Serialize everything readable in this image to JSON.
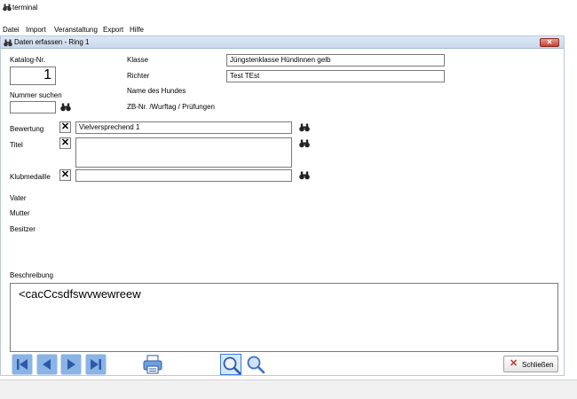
{
  "app": {
    "title": "terminal",
    "icon": "binoculars-icon"
  },
  "menu": [
    "Datei",
    "Import",
    "Veranstaltung",
    "Export",
    "Hilfe"
  ],
  "window": {
    "title": "Daten erfassen - Ring 1",
    "icon": "binoculars-icon",
    "close_label": "✕"
  },
  "form": {
    "katalog_label": "Katalog-Nr.",
    "katalog_value": "1",
    "nummer_suchen_label": "Nummer suchen",
    "nummer_suchen_value": "",
    "klasse_label": "Klasse",
    "klasse_value": "Jüngstenklasse Hündinnen gelb",
    "richter_label": "Richter",
    "richter_value": "Test TEst",
    "name_label": "Name des Hundes",
    "zb_label": "ZB-Nr. /Wurftag / Prüfungen",
    "bewertung_label": "Bewertung",
    "bewertung_value": "Vielversprechend 1",
    "titel_label": "Titel",
    "titel_value": "",
    "klubmedaille_label": "Klubmedaille",
    "klubmedaille_value": "",
    "vater_label": "Vater",
    "mutter_label": "Mutter",
    "besitzer_label": "Besitzer",
    "beschreibung_label": "Beschreibung",
    "beschreibung_value": "<cacCcsdfswvwewreew"
  },
  "buttons": {
    "close_label": "Schließen",
    "clear_symbol": "✕"
  },
  "colors": {
    "nav_blue": "#3d6fc4",
    "close_red": "#c0392b",
    "titlebar": "#c9d9ec"
  }
}
